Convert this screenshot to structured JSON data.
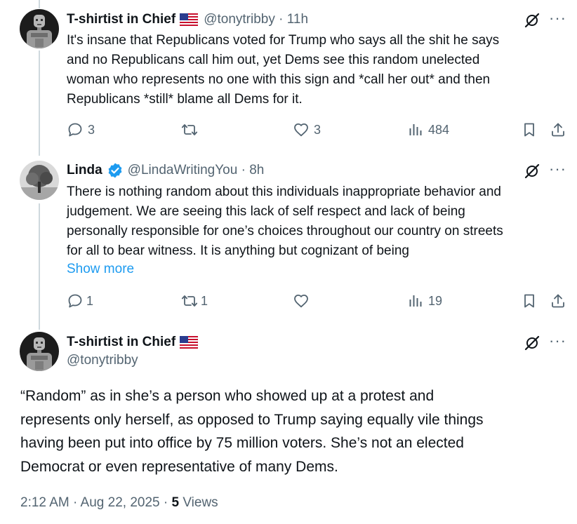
{
  "tweets": [
    {
      "name": "T-shirtist in Chief",
      "handle": "@tonytribby",
      "time": "11h",
      "text_lines": [
        "It's insane that Republicans voted for Trump who says all the shit he says",
        "and no Republicans call him out, yet Dems see this random unelected",
        "woman who represents no one with this sign and *call her out* and then",
        "Republicans *still* blame all Dems for it."
      ],
      "replies": "3",
      "retweets": "",
      "likes": "3",
      "views": "484"
    },
    {
      "name": "Linda",
      "handle": "@LindaWritingYou",
      "time": "8h",
      "text_lines": [
        "There is nothing random about this individuals inappropriate behavior and",
        "judgement. We are seeing this lack of self respect and lack of being",
        "personally responsible for one’s choices throughout our country on streets",
        "for all to bear witness. It is anything but cognizant of being"
      ],
      "show_more": "Show more",
      "replies": "1",
      "retweets": "1",
      "likes": "",
      "views": "19"
    }
  ],
  "main_tweet": {
    "name": "T-shirtist in Chief",
    "handle": "@tonytribby",
    "text_lines": [
      "“Random” as in she’s a person who showed up at a protest and",
      "represents only herself, as opposed to Trump saying equally vile things",
      "having been put into office by 75 million voters. She’s not an elected",
      "Democrat or even representative of many Dems."
    ],
    "timestamp": "2:12 AM · Aug 22, 2025",
    "dot": " · ",
    "views_count": "5",
    "views_label": "Views"
  },
  "separator": " · ",
  "more_glyph": "···",
  "icons": [
    "grok-icon",
    "more-icon",
    "reply-icon",
    "retweet-icon",
    "like-icon",
    "views-icon",
    "bookmark-icon",
    "share-icon",
    "verified-badge-icon",
    "us-flag-icon"
  ],
  "colors": {
    "text": "#0f1419",
    "secondary": "#536471",
    "link": "#1d9bf0",
    "thread_line": "#cfd9de"
  }
}
